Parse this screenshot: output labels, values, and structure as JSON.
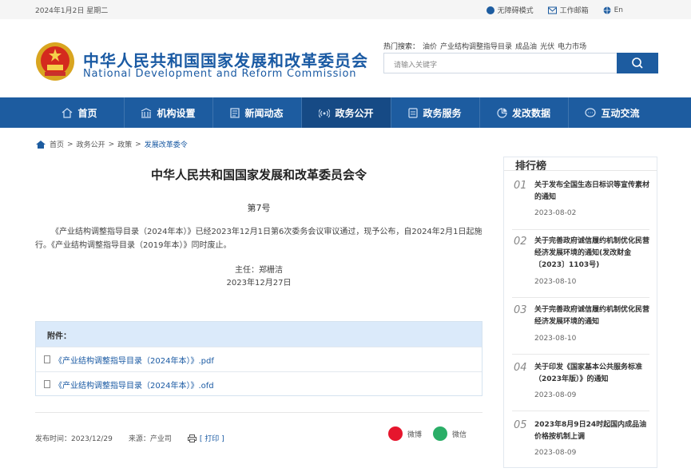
{
  "topbar": {
    "date": "2024年1月2日 星期二",
    "links": [
      {
        "label": "无障碍模式",
        "icon": "accessibility-icon"
      },
      {
        "label": "工作邮箱",
        "icon": "mail-icon"
      },
      {
        "label": "En",
        "icon": "globe-icon"
      }
    ]
  },
  "header": {
    "cn_title": "中华人民共和国国家发展和改革委员会",
    "en_title": "National Development and Reform Commission",
    "hot_label": "热门搜索：",
    "hot_keywords": [
      "油价",
      "产业结构调整指导目录",
      "成品油",
      "光伏",
      "电力市场"
    ],
    "search_placeholder": "请输入关键字"
  },
  "nav": [
    {
      "label": "首页",
      "icon": "home-icon"
    },
    {
      "label": "机构设置",
      "icon": "building-icon"
    },
    {
      "label": "新闻动态",
      "icon": "news-icon"
    },
    {
      "label": "政务公开",
      "icon": "broadcast-icon",
      "active": true
    },
    {
      "label": "政务服务",
      "icon": "service-icon"
    },
    {
      "label": "发改数据",
      "icon": "chart-icon"
    },
    {
      "label": "互动交流",
      "icon": "chat-icon"
    }
  ],
  "breadcrumb": [
    "首页",
    "政务公开",
    "政策",
    "发展改革委令"
  ],
  "article": {
    "title": "中华人民共和国国家发展和改革委员会令",
    "number": "第7号",
    "body": "《产业结构调整指导目录（2024年本）》已经2023年12月1日第6次委务会议审议通过，现予公布，自2024年2月1日起施行。《产业结构调整指导目录（2019年本）》同时废止。",
    "signer": "主任：郑栅洁",
    "sign_date": "2023年12月27日"
  },
  "attachments": {
    "header": "附件：",
    "files": [
      "《产业结构调整指导目录（2024年本）》.pdf",
      "《产业结构调整指导目录（2024年本）》.ofd"
    ]
  },
  "meta": {
    "publish": "发布时间：2023/12/29",
    "source": "来源：产业司",
    "print": "[ 打印 ]"
  },
  "share": [
    {
      "label": "微博",
      "icon": "weibo-icon",
      "color": "#e6162d"
    },
    {
      "label": "微信",
      "icon": "wechat-icon",
      "color": "#2aae67"
    }
  ],
  "ranking": {
    "title": "排行榜",
    "items": [
      {
        "no": "01",
        "title": "关于发布全国生态日标识等宣传素材的通知",
        "date": "2023-08-02"
      },
      {
        "no": "02",
        "title": "关于完善政府诚信履约机制优化民营经济发展环境的通知(发改财金〔2023〕1103号)",
        "date": "2023-08-10"
      },
      {
        "no": "03",
        "title": "关于完善政府诚信履约机制优化民营经济发展环境的通知",
        "date": "2023-08-10"
      },
      {
        "no": "04",
        "title": "关于印发《国家基本公共服务标准（2023年版）》的通知",
        "date": "2023-08-09"
      },
      {
        "no": "05",
        "title": "2023年8月9日24时起国内成品油价格按机制上调",
        "date": "2023-08-09"
      }
    ]
  }
}
